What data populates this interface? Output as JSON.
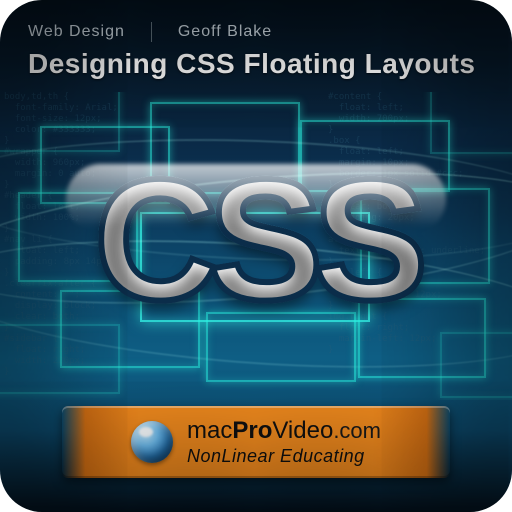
{
  "header": {
    "category": "Web Design",
    "author": "Geoff Blake"
  },
  "title": "Designing CSS Floating Layouts",
  "monogram": "CSS",
  "brand": {
    "word_mac": "mac",
    "word_pro": "Pro",
    "word_video": "Video",
    "word_dotcom": ".com",
    "tagline": "NonLinear Educating"
  },
  "code_bg_left": "body,td,th {\n  font-family: Arial;\n  font-size: 12px;\n  color: #333333;\n}\n#wrapper {\n  width: 960px;\n  margin: 0 auto;\n}\n#header {\n  float: left;\n  width: 100%;\n}\n#nav li {\n  float: left;\n  padding: 8px 14px;\n}\n.clearfix:after {\n  content: \"\";\n  display: block;\n  clear: both;\n}\n#sidebar {\n  float: right;\n  width: 220px;\n}\n",
  "code_bg_right": "#content {\n  float: left;\n  width: 700px;\n}\n.box {\n  float: left;\n  margin: 10px;\n  border: 1px solid #ccc;\n}\n#footer {\n  clear: both;\n  padding: 20px;\n}\na:hover {\n  text-decoration: underline;\n}\nimg.left {\n  float: left;\n  margin-right: 12px;\n}\nimg.right {\n  float: right;\n  margin-left: 12px;\n}\n"
}
